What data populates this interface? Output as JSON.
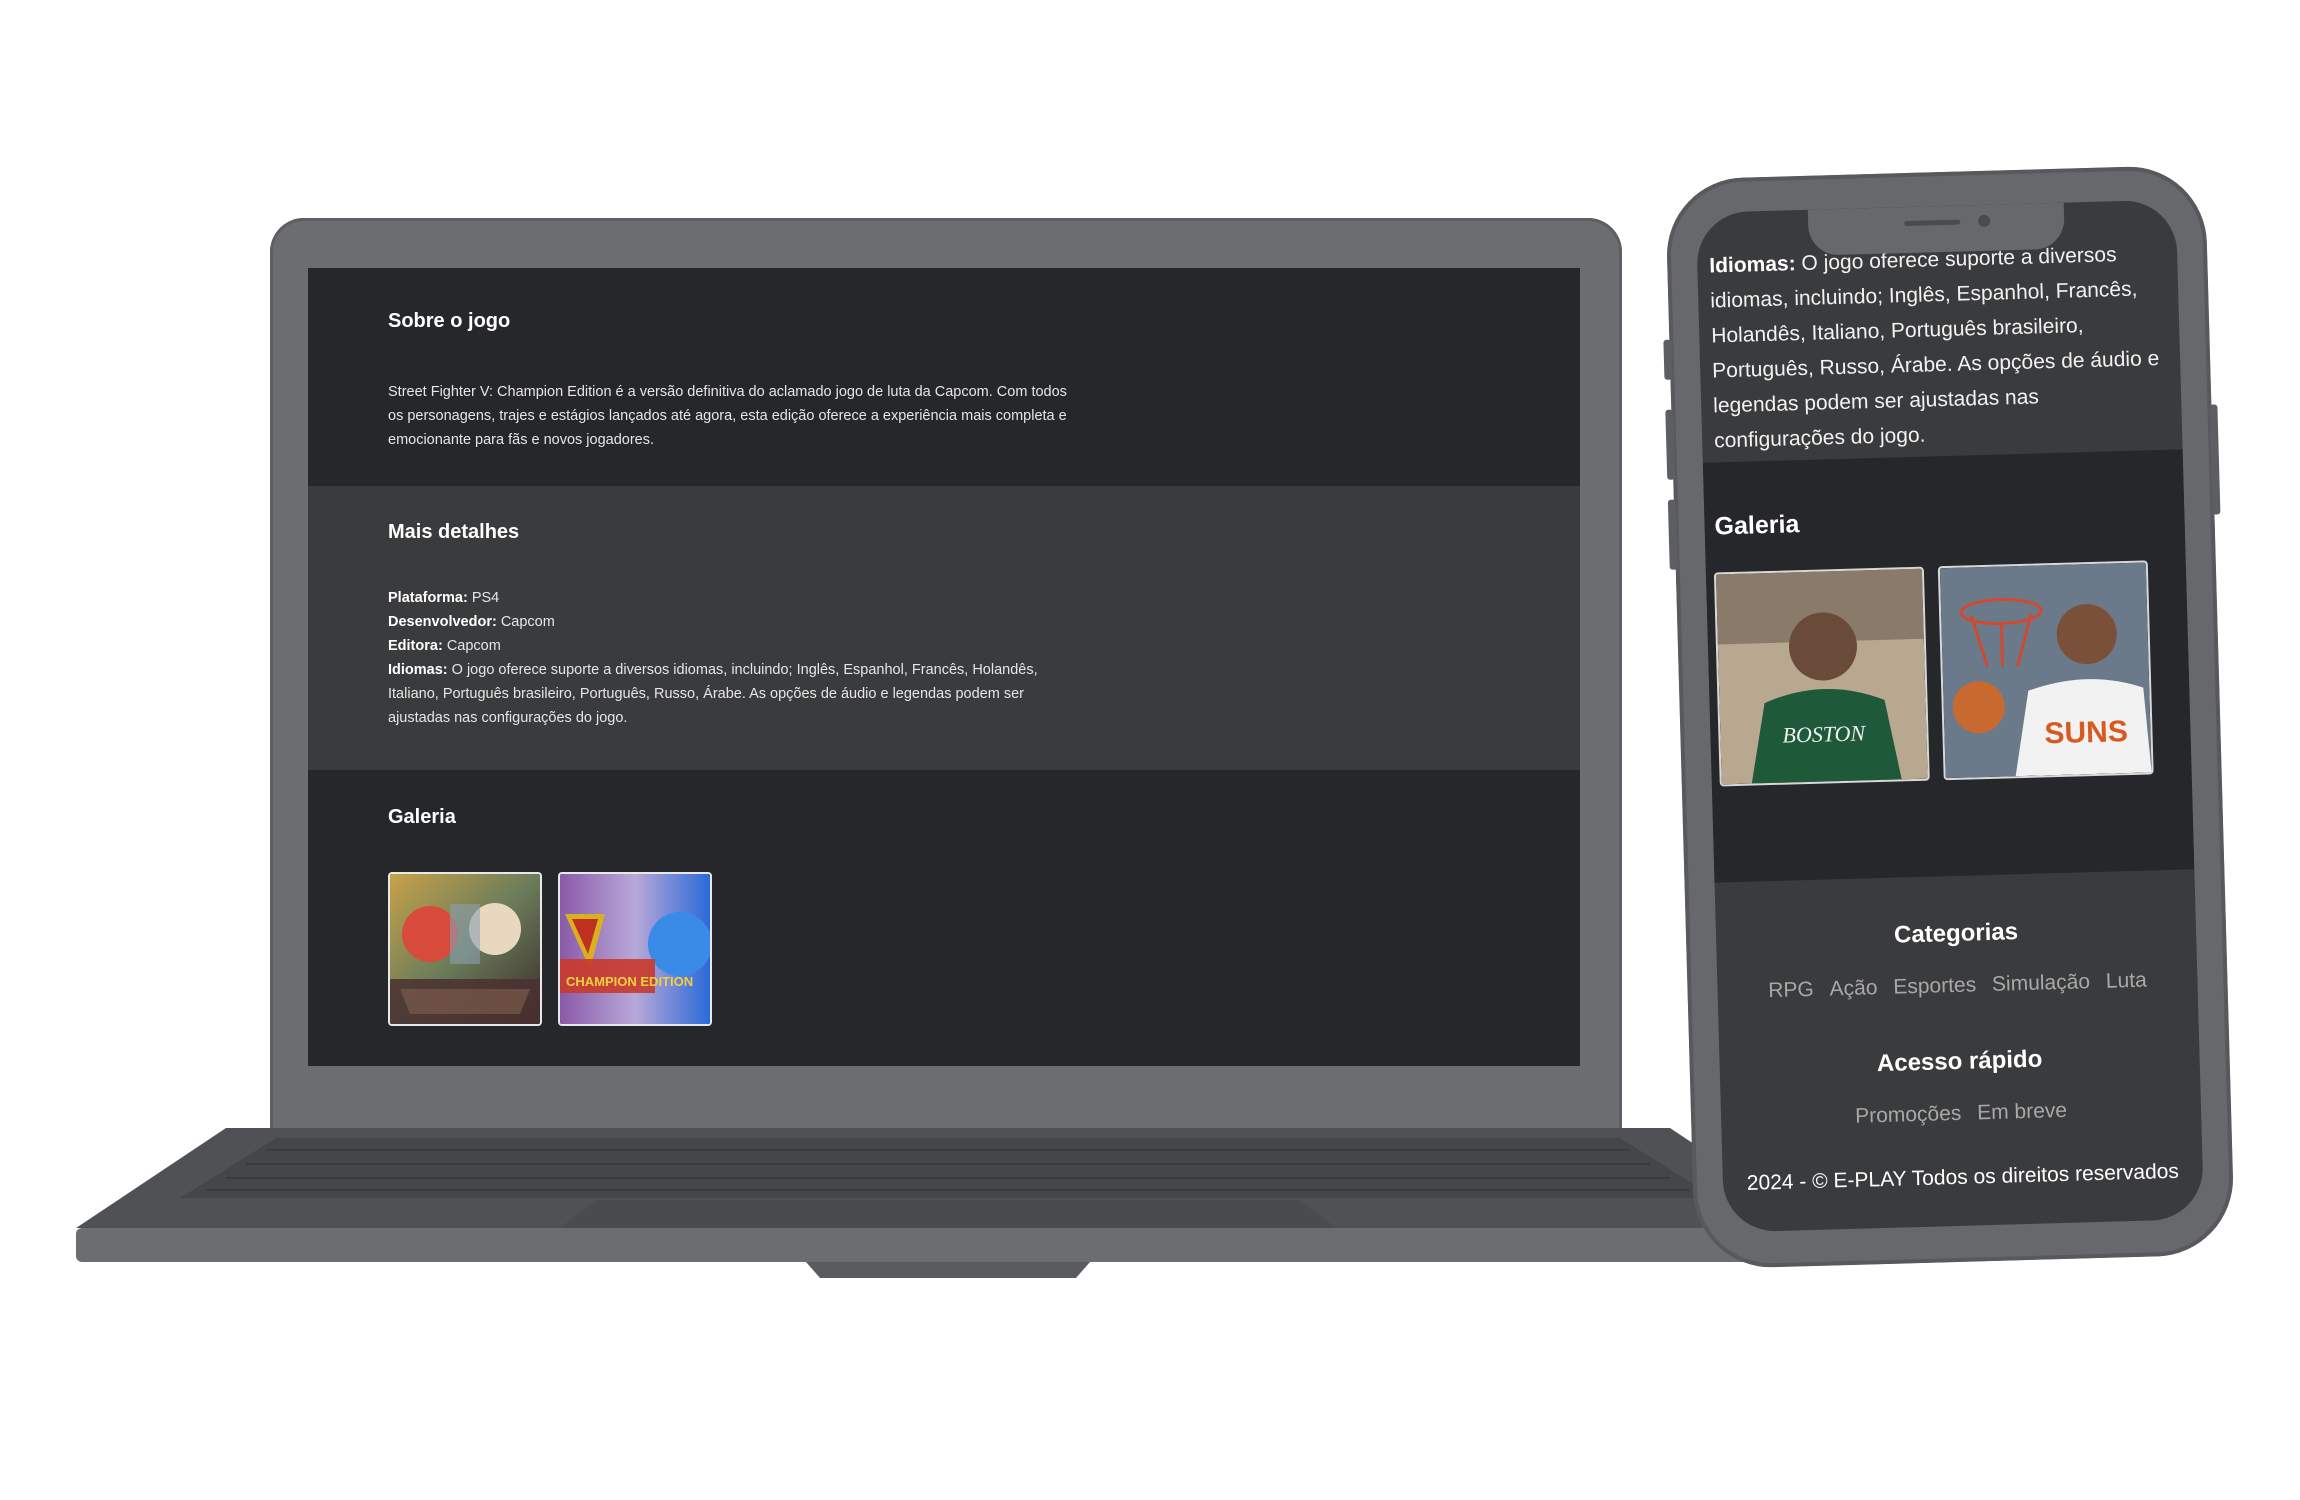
{
  "laptop": {
    "about": {
      "title": "Sobre o jogo",
      "text": "Street Fighter V: Champion Edition é a versão definitiva do aclamado jogo de luta da Capcom. Com todos os personagens, trajes e estágios lançados até agora, esta edição oferece a experiência mais completa e emocionante para fãs e novos jogadores."
    },
    "details": {
      "title": "Mais detalhes",
      "platform_label": "Plataforma:",
      "platform_value": "PS4",
      "developer_label": "Desenvolvedor:",
      "developer_value": "Capcom",
      "publisher_label": "Editora:",
      "publisher_value": "Capcom",
      "languages_label": "Idiomas:",
      "languages_value": "O jogo oferece suporte a diversos idiomas,  incluindo; Inglês, Espanhol, Francês, Holandês, Italiano, Português brasileiro, Português, Russo, Árabe. As opções de áudio e legendas podem ser ajustadas nas configurações do jogo."
    },
    "gallery": {
      "title": "Galeria",
      "thumb2_text": "CHAMPION EDITION"
    }
  },
  "phone": {
    "languages_label": "Idiomas:",
    "languages_value": "O jogo oferece suporte a diversos idiomas,  incluindo; Inglês, Espanhol, Francês, Holandês, Italiano, Português brasileiro, Português, Russo, Árabe. As opções de áudio e legendas podem ser ajustadas nas configurações do jogo.",
    "gallery_title": "Galeria",
    "thumb1_text": "BOSTON",
    "thumb2_text": "SUNS",
    "categories_title": "Categorias",
    "categories": [
      "RPG",
      "Ação",
      "Esportes",
      "Simulação",
      "Luta"
    ],
    "quick_access_title": "Acesso rápido",
    "quick_links": [
      "Promoções",
      "Em breve"
    ],
    "copyright": "2024 - © E-PLAY Todos os direitos reservados"
  },
  "colors": {
    "section_dark": "#26272a",
    "section_mid": "#3a3b3d",
    "device_gray": "#6c6d70"
  }
}
